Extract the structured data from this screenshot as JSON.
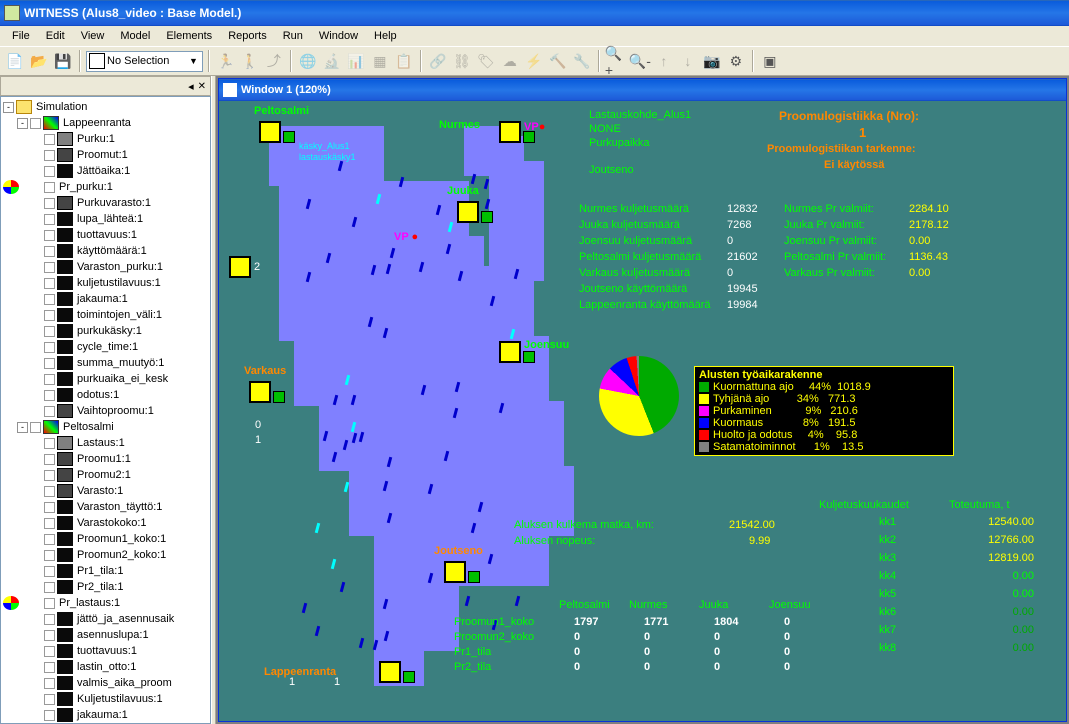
{
  "titlebar": {
    "text": "WITNESS (Alus8_video : Base Model.)"
  },
  "menu": {
    "file": "File",
    "edit": "Edit",
    "view": "View",
    "model": "Model",
    "elements": "Elements",
    "reports": "Reports",
    "run": "Run",
    "window": "Window",
    "help": "Help"
  },
  "toolbar": {
    "selection": "No Selection"
  },
  "tree": {
    "root": "Simulation",
    "group1": "Lappeenranta",
    "g1items": [
      "Purku:1",
      "Proomut:1",
      "Jättöaika:1",
      "Pr_purku:1",
      "Purkuvarasto:1",
      "lupa_lähteä:1",
      "tuottavuus:1",
      "käyttömäärä:1",
      "Varaston_purku:1",
      "kuljetustilavuus:1",
      "jakauma:1",
      "toimintojen_väli:1",
      "purkukäsky:1",
      "cycle_time:1",
      "summa_muutyö:1",
      "purkuaika_ei_kesk",
      "odotus:1",
      "Vaihtoproomu:1"
    ],
    "group2": "Peltosalmi",
    "g2items": [
      "Lastaus:1",
      "Proomu1:1",
      "Proomu2:1",
      "Varasto:1",
      "Varaston_täyttö:1",
      "Varastokoko:1",
      "Proomun1_koko:1",
      "Proomun2_koko:1",
      "Pr1_tila:1",
      "Pr2_tila:1",
      "Pr_lastaus:1",
      "jättö_ja_asennusaik",
      "asennuslupa:1",
      "tuottavuus:1",
      "lastin_otto:1",
      "valmis_aika_proom",
      "Kuljetustilavuus:1",
      "jakauma:1"
    ]
  },
  "subwindow": {
    "title": "Window 1 (120%)"
  },
  "map": {
    "places": {
      "peltosalmi": "Peltosalmi",
      "nurmes": "Nurmes",
      "juuka": "Juuka",
      "joensuu": "Joensuu",
      "varkaus": "Varkaus",
      "joutseno": "Joutseno",
      "lappeenranta": "Lappeenranta",
      "vp": "VP",
      "vp2": "VP"
    },
    "kasky": "käsky_Alus1",
    "lastausk": "lastauskäsky1",
    "lastauskohde": "Lastauskohde_Alus1",
    "none": "NONE",
    "purkupaikka": "Purkupaikka",
    "joutsenov": "Joutseno",
    "header1": "Proomulogistiikka (Nro):",
    "header1v": "1",
    "header2": "Proomulogistiikan tarkenne:",
    "header2v": "Ei käytössä",
    "stats": [
      {
        "l": "Nurmes kuljetusmäärä",
        "v": "12832"
      },
      {
        "l": "Juuka kuljetusmäärä",
        "v": "7268"
      },
      {
        "l": "Joensuu kuljetusmäärä",
        "v": "0"
      },
      {
        "l": "Peltosalmi kuljetusmäärä",
        "v": "21602"
      },
      {
        "l": "Varkaus kuljetusmäärä",
        "v": "0"
      },
      {
        "l": "Joutseno käyttömäärä",
        "v": "19945"
      },
      {
        "l": "Lappeenranta käyttömäärä",
        "v": "19984"
      }
    ],
    "valmiit": [
      {
        "l": "Nurmes Pr valmiit:",
        "v": "2284.10"
      },
      {
        "l": "Juuka Pr valmiit:",
        "v": "2178.12"
      },
      {
        "l": "Joensuu Pr valmiit:",
        "v": "0.00"
      },
      {
        "l": "Peltosalmi Pr valmiit:",
        "v": "1136.43"
      },
      {
        "l": "Varkaus Pr valmiit:",
        "v": "0.00"
      }
    ],
    "legend_title": "Alusten työaikarakenne",
    "legend": [
      {
        "c": "#00aa00",
        "l": "Kuormattuna ajo",
        "p": "44%",
        "v": "1018.9"
      },
      {
        "c": "#ffff00",
        "l": "Tyhjänä ajo",
        "p": "34%",
        "v": "771.3"
      },
      {
        "c": "#ff00ff",
        "l": "Purkaminen",
        "p": "9%",
        "v": "210.6"
      },
      {
        "c": "#0000ff",
        "l": "Kuormaus",
        "p": "8%",
        "v": "191.5"
      },
      {
        "c": "#ff0000",
        "l": "Huolto ja odotus",
        "p": "4%",
        "v": "95.8"
      },
      {
        "c": "#808080",
        "l": "Satamatoiminnot",
        "p": "1%",
        "v": "13.5"
      }
    ],
    "matka_l": "Aluksen kulkema matka, km:",
    "matka_v": "21542.00",
    "nopeus_l": "Aluksen nopeus:",
    "nopeus_v": "9.99",
    "kk_header": "Kuljetuskuukaudet",
    "tot_header": "Toteutuma, t",
    "kk": [
      {
        "l": "kk1",
        "v": "12540.00"
      },
      {
        "l": "kk2",
        "v": "12766.00"
      },
      {
        "l": "kk3",
        "v": "12819.00"
      },
      {
        "l": "kk4",
        "v": "0.00"
      },
      {
        "l": "kk5",
        "v": "0.00"
      },
      {
        "l": "kk6",
        "v": "0.00"
      },
      {
        "l": "kk7",
        "v": "0.00"
      },
      {
        "l": "kk8",
        "v": "0.00"
      }
    ],
    "table_cols": [
      "Peltosalmi",
      "Nurmes",
      "Juuka",
      "Joensuu"
    ],
    "table": [
      {
        "l": "Proomun1_koko",
        "v": [
          "1797",
          "1771",
          "1804",
          "0"
        ]
      },
      {
        "l": "Proomun2_koko",
        "v": [
          "0",
          "0",
          "0",
          "0"
        ]
      },
      {
        "l": "Pr1_tila",
        "v": [
          "0",
          "0",
          "0",
          "0"
        ]
      },
      {
        "l": "Pr2_tila",
        "v": [
          "0",
          "0",
          "0",
          "0"
        ]
      }
    ],
    "counters": {
      "c1": "2",
      "c2_1": "0",
      "c2_2": "1",
      "c3_1": "1",
      "c3_2": "1"
    }
  },
  "chart_data": {
    "type": "pie",
    "title": "Alusten työaikarakenne",
    "series": [
      {
        "name": "Kuormattuna ajo",
        "value": 1018.9,
        "pct": 44,
        "color": "#00aa00"
      },
      {
        "name": "Tyhjänä ajo",
        "value": 771.3,
        "pct": 34,
        "color": "#ffff00"
      },
      {
        "name": "Purkaminen",
        "value": 210.6,
        "pct": 9,
        "color": "#ff00ff"
      },
      {
        "name": "Kuormaus",
        "value": 191.5,
        "pct": 8,
        "color": "#0000ff"
      },
      {
        "name": "Huolto ja odotus",
        "value": 95.8,
        "pct": 4,
        "color": "#ff0000"
      },
      {
        "name": "Satamatoiminnot",
        "value": 13.5,
        "pct": 1,
        "color": "#808080"
      }
    ]
  }
}
